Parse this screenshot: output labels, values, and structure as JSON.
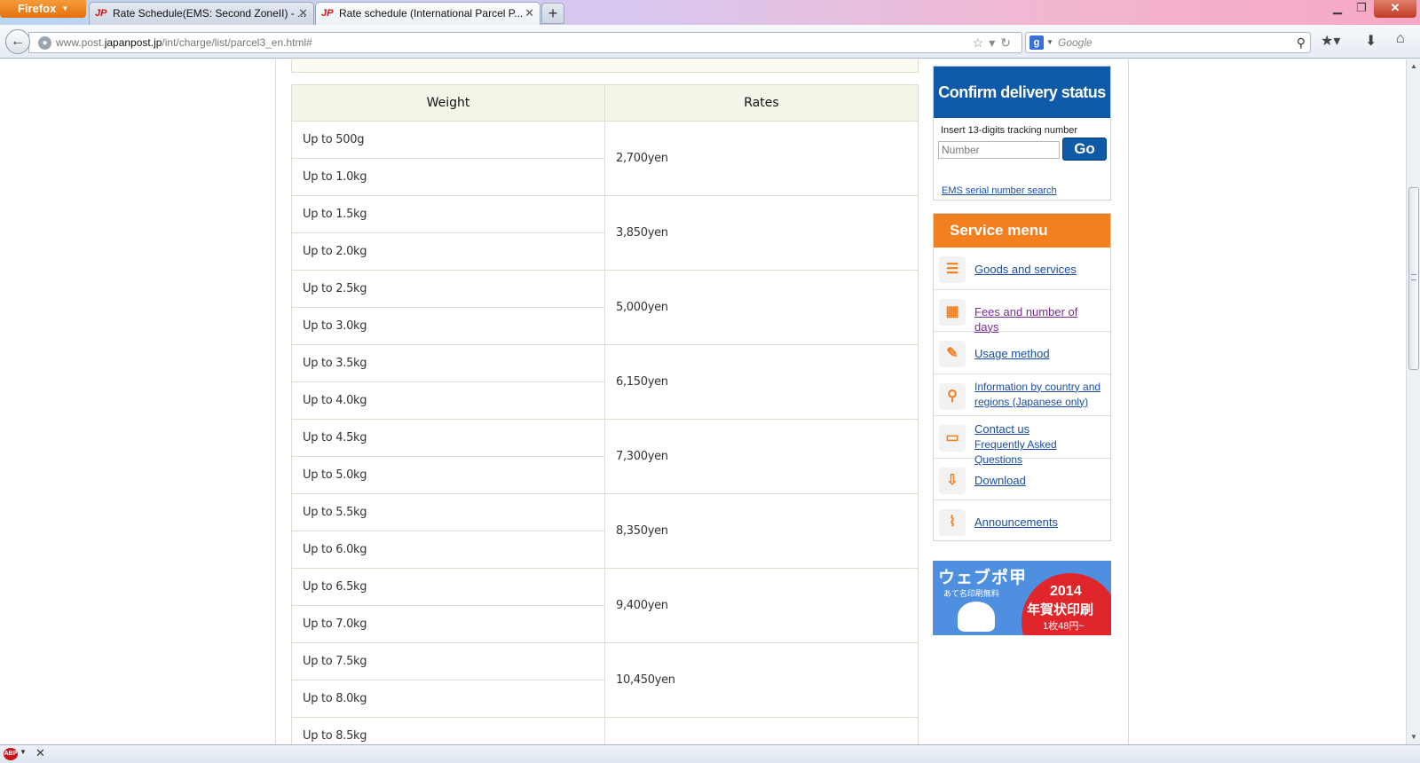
{
  "browser": {
    "menu_label": "Firefox",
    "tabs": [
      {
        "title": "Rate Schedule(EMS: Second ZoneII) - ...",
        "active": false
      },
      {
        "title": "Rate schedule (International Parcel P...",
        "active": true
      }
    ],
    "url_prefix": "www.post.",
    "url_domain": "japanpost.jp",
    "url_path": "/int/charge/list/parcel3_en.html#",
    "search_placeholder": "Google"
  },
  "table": {
    "headers": [
      "Weight",
      "Rates"
    ],
    "rows": [
      {
        "weights": [
          "Up to 500g",
          "Up to 1.0kg"
        ],
        "rate": "2,700yen"
      },
      {
        "weights": [
          "Up to 1.5kg",
          "Up to 2.0kg"
        ],
        "rate": "3,850yen"
      },
      {
        "weights": [
          "Up to 2.5kg",
          "Up to 3.0kg"
        ],
        "rate": "5,000yen"
      },
      {
        "weights": [
          "Up to 3.5kg",
          "Up to 4.0kg"
        ],
        "rate": "6,150yen"
      },
      {
        "weights": [
          "Up to 4.5kg",
          "Up to 5.0kg"
        ],
        "rate": "7,300yen"
      },
      {
        "weights": [
          "Up to 5.5kg",
          "Up to 6.0kg"
        ],
        "rate": "8,350yen"
      },
      {
        "weights": [
          "Up to 6.5kg",
          "Up to 7.0kg"
        ],
        "rate": "9,400yen"
      },
      {
        "weights": [
          "Up to 7.5kg",
          "Up to 8.0kg"
        ],
        "rate": "10,450yen"
      },
      {
        "weights": [
          "Up to 8.5kg"
        ],
        "rate": ""
      }
    ]
  },
  "sidebar": {
    "confirm": {
      "title": "Confirm delivery status",
      "hint": "Insert 13-digits tracking number",
      "placeholder": "Number",
      "go_label": "Go",
      "ems_link": "EMS serial number search"
    },
    "menu": {
      "title": "Service menu",
      "items": [
        {
          "label": "Goods and services",
          "icon": "list-icon"
        },
        {
          "label": "Fees and number of days",
          "icon": "calendar-icon"
        },
        {
          "label": "Usage method",
          "icon": "edit-icon"
        },
        {
          "label": "Information by country and regions (Japanese only)",
          "icon": "map-pin-icon"
        },
        {
          "label": "Contact us",
          "label2": "Frequently Asked Questions",
          "icon": "chat-icon"
        },
        {
          "label": "Download",
          "icon": "download-icon"
        },
        {
          "label": "Announcements",
          "icon": "paperclip-icon"
        }
      ]
    },
    "banner": {
      "title": "ウェブポ甲",
      "sub": "あて名印刷無料",
      "year": "2014",
      "main": "年賀状印刷",
      "price": "1枚48円~"
    }
  },
  "colors": {
    "accent_blue": "#0f5aa8",
    "accent_orange": "#f37f1e",
    "link": "#1a4ea0",
    "table_header_bg": "#f4f4e9"
  }
}
